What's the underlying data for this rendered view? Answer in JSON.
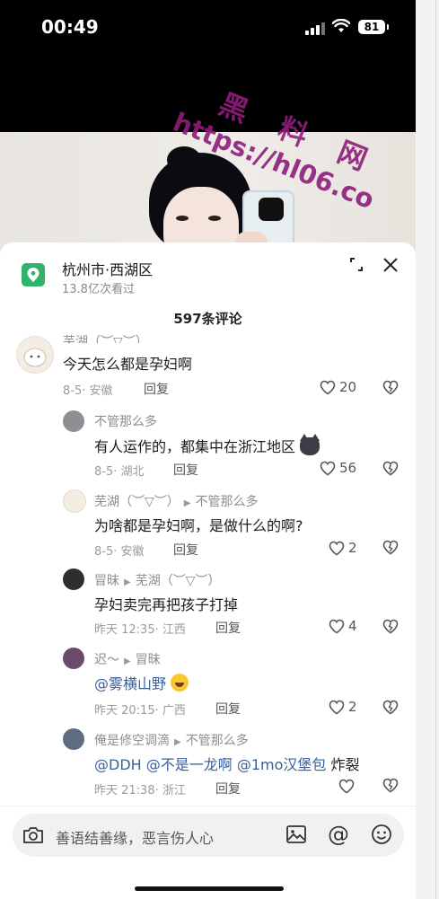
{
  "status_bar": {
    "time": "00:49",
    "battery": "81"
  },
  "watermark": {
    "title": "黑 料 网",
    "url": "https://hl06.co"
  },
  "location": {
    "title": "杭州市·西湖区",
    "views": "13.8亿次看过"
  },
  "comment_count": "597条评论",
  "comments": [
    {
      "user": "芜湖（︶▽︶）",
      "text": "今天怎么都是孕妇啊",
      "date": "8-5",
      "place": "安徽",
      "reply": "回复",
      "likes": "20"
    },
    {
      "user": "不管那么多",
      "text": "有人运作的，都集中在浙江地区",
      "date": "8-5",
      "place": "湖北",
      "reply": "回复",
      "likes": "56"
    },
    {
      "user": "芜湖（︶▽︶）",
      "to": "不管那么多",
      "text": "为啥都是孕妇啊，是做什么的啊?",
      "date": "8-5",
      "place": "安徽",
      "reply": "回复",
      "likes": "2"
    },
    {
      "user": "冒昧",
      "to": "芜湖（︶▽︶）",
      "text": "孕妇卖完再把孩子打掉",
      "date": "昨天 12:35",
      "place": "江西",
      "reply": "回复",
      "likes": "4"
    },
    {
      "user": "迟～",
      "to": "冒昧",
      "text": "@雾横山野",
      "date": "昨天 20:15",
      "place": "广西",
      "reply": "回复",
      "likes": "2"
    },
    {
      "user": "俺是修空调滴",
      "to": "不管那么多",
      "mention1": "@DDH",
      "mention2": "@不是一龙啊",
      "mention3": "@1mo汉堡包",
      "text_after": "炸裂",
      "date": "昨天 21:38",
      "place": "浙江",
      "reply": "回复",
      "likes": ""
    }
  ],
  "input": {
    "placeholder": "善语结善缘，恶言伤人心"
  },
  "colors": {
    "location_green": "#31b36b",
    "mention_blue": "#3a5f9a",
    "watermark_purple": "#8f1d7c"
  }
}
